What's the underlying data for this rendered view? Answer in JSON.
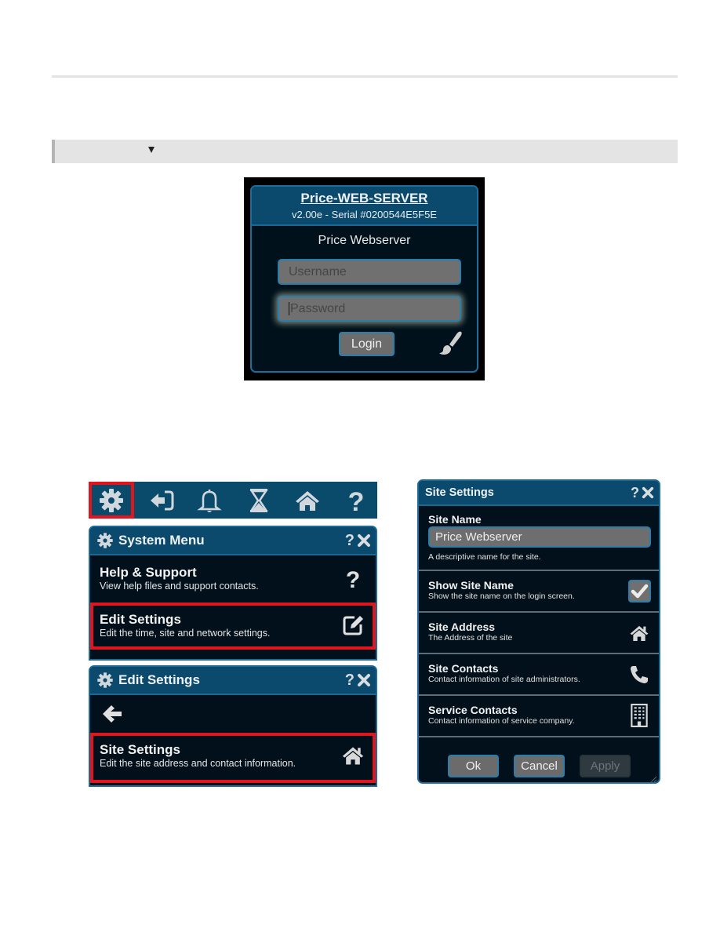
{
  "document": {
    "collapse_toggle": "expand-collapse",
    "colors": {
      "panel_bg": "#01101a",
      "header_bg": "#0b4a6c",
      "border": "#1d6a96",
      "highlight": "#e2141d"
    }
  },
  "login": {
    "title": "Price-WEB-SERVER",
    "serial": "v2.00e - Serial #0200544E5F5E",
    "site_name": "Price Webserver",
    "username_placeholder": "Username",
    "password_placeholder": "Password",
    "login_label": "Login",
    "theme_icon": "paintbrush-icon"
  },
  "toolbar": {
    "items": [
      {
        "name": "settings",
        "icon": "gear-icon",
        "active": true
      },
      {
        "name": "logout",
        "icon": "sign-out-icon"
      },
      {
        "name": "alarms",
        "icon": "bell-icon"
      },
      {
        "name": "schedules",
        "icon": "hourglass-icon"
      },
      {
        "name": "home",
        "icon": "home-icon"
      },
      {
        "name": "help",
        "icon": "question-icon"
      }
    ]
  },
  "system_menu": {
    "title": "System Menu",
    "help_label": "?",
    "items": [
      {
        "title": "Help & Support",
        "desc": "View help files and support contacts.",
        "icon": "question-icon"
      },
      {
        "title": "Edit Settings",
        "desc": "Edit the time, site and network settings.",
        "icon": "edit-icon",
        "highlighted": true
      }
    ]
  },
  "edit_settings": {
    "title": "Edit Settings",
    "help_label": "?",
    "items": [
      {
        "title": "Site Settings",
        "desc": "Edit the site address and contact information.",
        "icon": "home-icon",
        "highlighted": true
      }
    ]
  },
  "site_settings": {
    "title": "Site Settings",
    "help_label": "?",
    "site_name": {
      "label": "Site Name",
      "value": "Price Webserver",
      "desc": "A descriptive name for the site."
    },
    "show_site_name": {
      "label": "Show Site Name",
      "desc": "Show the site name on the login screen.",
      "checked": true
    },
    "rows": [
      {
        "label": "Site Address",
        "desc": "The Address of the site",
        "icon": "home-icon"
      },
      {
        "label": "Site Contacts",
        "desc": "Contact information of site administrators.",
        "icon": "phone-icon"
      },
      {
        "label": "Service Contacts",
        "desc": "Contact information of service company.",
        "icon": "building-icon"
      }
    ],
    "buttons": {
      "ok": "Ok",
      "cancel": "Cancel",
      "apply": "Apply"
    }
  }
}
